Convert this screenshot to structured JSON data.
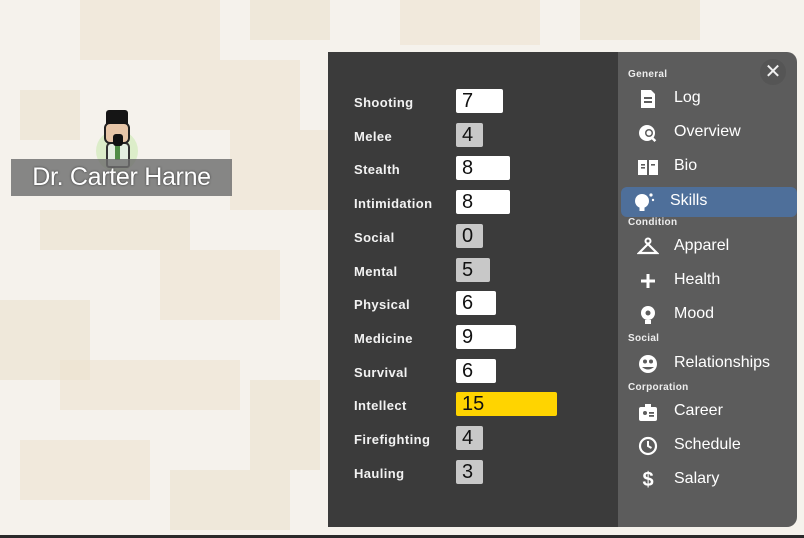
{
  "character": {
    "name": "Dr. Carter Harne"
  },
  "close_icon": "✕",
  "skills": [
    {
      "label": "Shooting",
      "value": "7",
      "level": 7
    },
    {
      "label": "Melee",
      "value": "4",
      "level": 4
    },
    {
      "label": "Stealth",
      "value": "8",
      "level": 8
    },
    {
      "label": "Intimidation",
      "value": "8",
      "level": 8
    },
    {
      "label": "Social",
      "value": "0",
      "level": 0
    },
    {
      "label": "Mental",
      "value": "5",
      "level": 5
    },
    {
      "label": "Physical",
      "value": "6",
      "level": 6
    },
    {
      "label": "Medicine",
      "value": "9",
      "level": 9
    },
    {
      "label": "Survival",
      "value": "6",
      "level": 6
    },
    {
      "label": "Intellect",
      "value": "15",
      "level": 15
    },
    {
      "label": "Firefighting",
      "value": "4",
      "level": 4
    },
    {
      "label": "Hauling",
      "value": "3",
      "level": 3
    }
  ],
  "nav": {
    "sections": {
      "general": "General",
      "condition": "Condition",
      "social": "Social",
      "corporation": "Corporation"
    },
    "items": [
      {
        "label": "Log",
        "icon": "log-icon"
      },
      {
        "label": "Overview",
        "icon": "overview-icon"
      },
      {
        "label": "Bio",
        "icon": "bio-icon"
      },
      {
        "label": "Skills",
        "icon": "skills-icon",
        "active": true
      },
      {
        "label": "Apparel",
        "icon": "apparel-icon"
      },
      {
        "label": "Health",
        "icon": "health-icon"
      },
      {
        "label": "Mood",
        "icon": "mood-icon"
      },
      {
        "label": "Relationships",
        "icon": "relationships-icon"
      },
      {
        "label": "Career",
        "icon": "career-icon"
      },
      {
        "label": "Schedule",
        "icon": "schedule-icon"
      },
      {
        "label": "Salary",
        "icon": "salary-icon"
      }
    ]
  },
  "colors": {
    "panel_dark": "#3b3b3b",
    "panel_nav": "#5c5c5c",
    "active_item": "#4e6f9a",
    "top_skill": "#ffd400"
  }
}
